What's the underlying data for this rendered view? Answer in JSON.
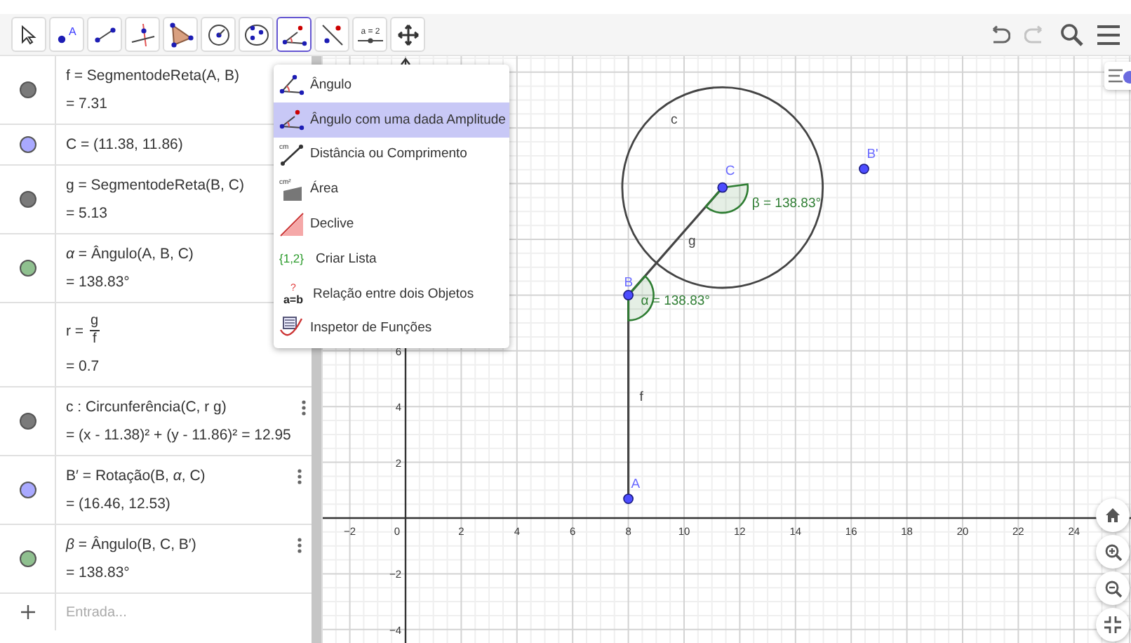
{
  "toolbar": {
    "tools": [
      {
        "kind": "move",
        "selected": false
      },
      {
        "kind": "point",
        "label": "A",
        "selected": false
      },
      {
        "kind": "segment",
        "selected": false
      },
      {
        "kind": "perpendicular",
        "selected": false
      },
      {
        "kind": "polygon",
        "selected": false
      },
      {
        "kind": "circle",
        "selected": false
      },
      {
        "kind": "conic",
        "selected": false
      },
      {
        "kind": "angle",
        "selected": true
      },
      {
        "kind": "reflect",
        "selected": false
      },
      {
        "kind": "slider",
        "label": "a = 2",
        "selected": false
      },
      {
        "kind": "move-view",
        "selected": false
      }
    ],
    "actions": [
      {
        "kind": "undo",
        "disabled": false
      },
      {
        "kind": "redo",
        "disabled": true
      },
      {
        "kind": "search"
      },
      {
        "kind": "menu"
      }
    ]
  },
  "algebra": {
    "items": [
      {
        "kind": "two-line",
        "color": "#7a7a7a",
        "definition": "f = SegmentodeReta(A, B)",
        "value": "= 7.31",
        "more": false
      },
      {
        "kind": "one-line",
        "color": "#a9a9ff",
        "definition": "C = (11.38, 11.86)",
        "more": false
      },
      {
        "kind": "two-line",
        "color": "#7a7a7a",
        "definition": "g = SegmentodeReta(B, C)",
        "value": "= 5.13",
        "more": false
      },
      {
        "kind": "two-line",
        "color": "#8fc08f",
        "definition": "*α* = Ângulo(A, B, C)",
        "value": "= 138.83°",
        "more": false
      },
      {
        "kind": "fraction",
        "name": "r =",
        "numerator": "g",
        "denominator": "f",
        "value": "= 0.7",
        "more": false
      },
      {
        "kind": "two-line",
        "color": "#7a7a7a",
        "definition": "c : Circunferência(C, r g)",
        "value": "= (x - 11.38)² + (y - 11.86)² = 12.95",
        "more": true
      },
      {
        "kind": "two-line",
        "color": "#a9a9ff",
        "definition": "B′ = Rotação(B, *α*, C)",
        "value": "= (16.46, 12.53)",
        "more": true
      },
      {
        "kind": "two-line",
        "color": "#8fc08f",
        "definition": "*β* = Ângulo(B, C, B′)",
        "value": "= 138.83°",
        "more": true
      }
    ],
    "input": {
      "placeholder": "Entrada..."
    }
  },
  "tool_menu": {
    "items": [
      {
        "kind": "angle",
        "label": "Ângulo",
        "selected": false
      },
      {
        "kind": "angle-amplitude",
        "label": "Ângulo com uma dada Amplitude",
        "selected": true
      },
      {
        "kind": "distance",
        "icon_text": "cm",
        "label": "Distância ou Comprimento",
        "selected": false
      },
      {
        "kind": "area",
        "icon_text": "cm²",
        "label": "Área",
        "selected": false
      },
      {
        "kind": "slope",
        "label": "Declive",
        "selected": false
      },
      {
        "kind": "list",
        "icon_text": "{1,2}",
        "label": "Criar Lista",
        "selected": false
      },
      {
        "kind": "relation",
        "icon_text": "a=b",
        "icon_mark": "?",
        "label": "Relação entre dois Objetos",
        "selected": false
      },
      {
        "kind": "function-inspector",
        "label": "Inspetor de Funções",
        "selected": false
      }
    ]
  },
  "graphics": {
    "x_labels": [
      "−2",
      "0",
      "2",
      "4",
      "6",
      "8",
      "10",
      "12",
      "14",
      "16",
      "18",
      "20",
      "22",
      "24"
    ],
    "y_labels": [
      "6",
      "4",
      "2",
      "−2",
      "−4"
    ],
    "points": [
      {
        "label": "A"
      },
      {
        "label": "B"
      },
      {
        "label": "C"
      },
      {
        "label": "B'"
      }
    ],
    "objects": [
      {
        "kind": "segment",
        "label": "f"
      },
      {
        "kind": "segment",
        "label": "g"
      },
      {
        "kind": "circle",
        "label": "c"
      },
      {
        "kind": "angle",
        "label": "α = 138.83°"
      },
      {
        "kind": "angle",
        "label": "β = 138.83°"
      }
    ]
  }
}
